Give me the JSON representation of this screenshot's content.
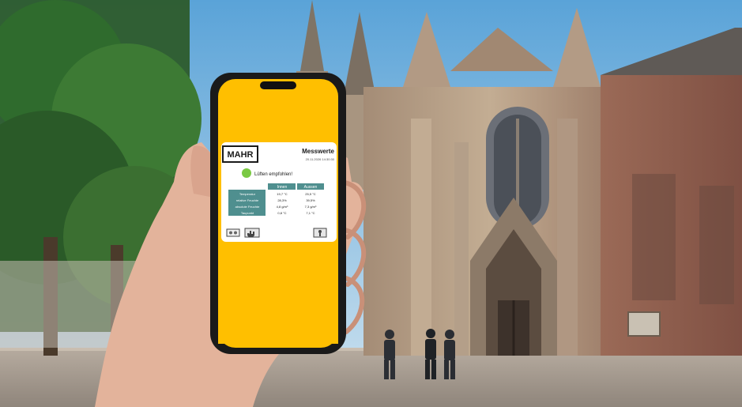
{
  "app": {
    "brand": "MAHR",
    "title": "Messwerte",
    "timestamp": "20.11.2026 14:30:30",
    "status_text": "Lüften empfohlen!",
    "status_color": "#7ac943",
    "accent_color": "#ffbf00",
    "header_color": "#4f8f8f",
    "table": {
      "columns": [
        "Innen",
        "Aussen"
      ],
      "rows": [
        {
          "label": "Temperatur",
          "innen": "19,7 °C",
          "aussen": "25,5 °C"
        },
        {
          "label": "relative Feuchte",
          "innen": "28,3%",
          "aussen": "39,5%"
        },
        {
          "label": "absolute Feuchte",
          "innen": "4,8 g/m³",
          "aussen": "7,3 g/m³"
        },
        {
          "label": "Taupunkt",
          "innen": "0,8 °C",
          "aussen": "7,1 °C"
        }
      ]
    },
    "footer_icons": [
      "settings-icon",
      "hand-icon",
      "key-icon"
    ]
  }
}
